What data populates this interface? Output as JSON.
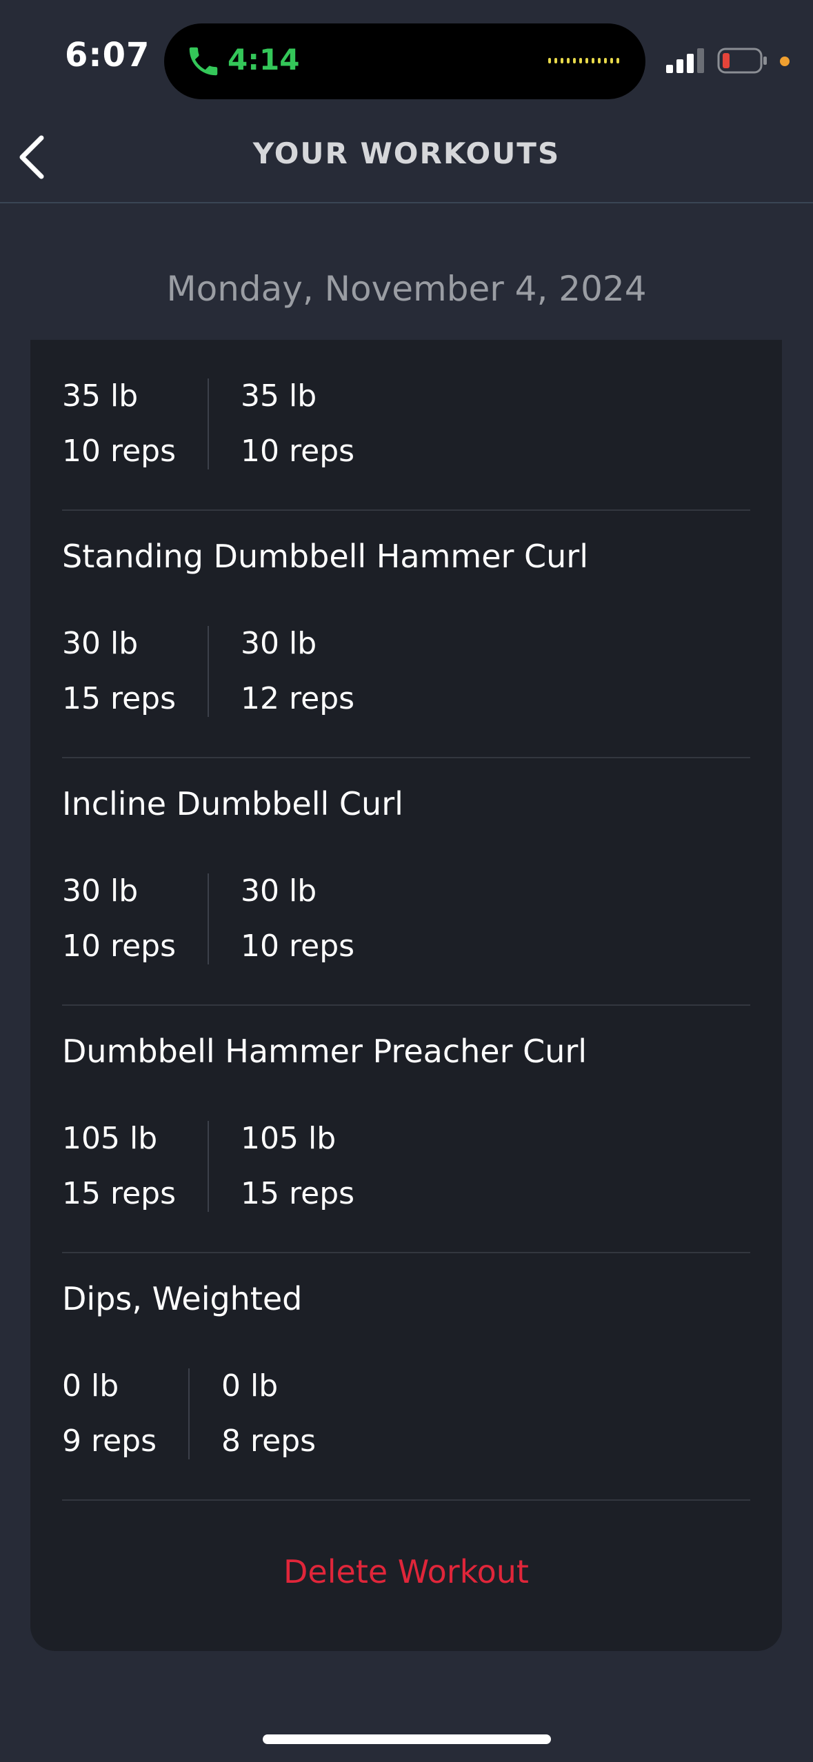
{
  "status_bar": {
    "time": "6:07",
    "call_duration": "4:14",
    "colors": {
      "call": "#34c759",
      "battery_low": "#e5443a",
      "mic_dot": "#f0a030"
    }
  },
  "nav": {
    "back_icon": "chevron-left-icon",
    "title": "YOUR WORKOUTS"
  },
  "workout": {
    "date": "Monday, November 4, 2024",
    "top_sets": [
      {
        "weight": "35 lb",
        "reps": "10 reps"
      },
      {
        "weight": "35 lb",
        "reps": "10 reps"
      }
    ],
    "exercises": [
      {
        "name": "Standing Dumbbell Hammer Curl",
        "sets": [
          {
            "weight": "30 lb",
            "reps": "15 reps"
          },
          {
            "weight": "30 lb",
            "reps": "12 reps"
          }
        ]
      },
      {
        "name": "Incline Dumbbell Curl",
        "sets": [
          {
            "weight": "30 lb",
            "reps": "10 reps"
          },
          {
            "weight": "30 lb",
            "reps": "10 reps"
          }
        ]
      },
      {
        "name": "Dumbbell Hammer Preacher Curl",
        "sets": [
          {
            "weight": "105 lb",
            "reps": "15 reps"
          },
          {
            "weight": "105 lb",
            "reps": "15 reps"
          }
        ]
      },
      {
        "name": "Dips, Weighted",
        "sets": [
          {
            "weight": "0 lb",
            "reps": "9 reps"
          },
          {
            "weight": "0 lb",
            "reps": "8 reps"
          }
        ]
      }
    ],
    "delete_label": "Delete Workout",
    "delete_color": "#e0263a"
  }
}
